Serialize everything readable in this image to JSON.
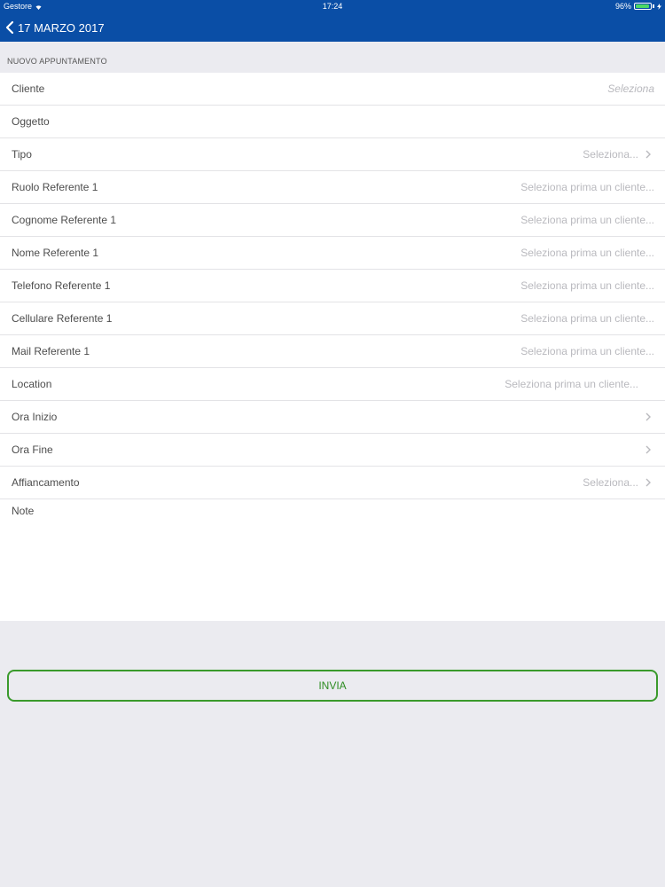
{
  "status_bar": {
    "carrier": "Gestore",
    "time": "17:24",
    "battery": "96%",
    "battery_level": 0.96
  },
  "nav": {
    "back_label": "17 MARZO 2017"
  },
  "section": {
    "title": "NUOVO APPUNTAMENTO"
  },
  "form": {
    "rows": [
      {
        "label": "Cliente",
        "value": "Seleziona"
      },
      {
        "label": "Oggetto",
        "value": ""
      },
      {
        "label": "Tipo",
        "value": "Seleziona..."
      },
      {
        "label": "Ruolo Referente 1",
        "value": "Seleziona prima un cliente..."
      },
      {
        "label": "Cognome Referente 1",
        "value": "Seleziona prima un cliente..."
      },
      {
        "label": "Nome Referente 1",
        "value": "Seleziona prima un cliente..."
      },
      {
        "label": "Telefono Referente 1",
        "value": "Seleziona prima un cliente..."
      },
      {
        "label": "Cellulare Referente 1",
        "value": "Seleziona prima un cliente..."
      },
      {
        "label": "Mail Referente 1",
        "value": "Seleziona prima un cliente..."
      },
      {
        "label": "Location",
        "value": "Seleziona prima un cliente..."
      },
      {
        "label": "Ora Inizio",
        "value": ""
      },
      {
        "label": "Ora Fine",
        "value": ""
      },
      {
        "label": "Affiancamento",
        "value": "Seleziona..."
      }
    ],
    "notes_label": "Note"
  },
  "submit": {
    "label": "INVIA"
  },
  "colors": {
    "header": "#0a4ea6",
    "accent_green": "#3a9a2c",
    "background": "#ebebf0"
  }
}
